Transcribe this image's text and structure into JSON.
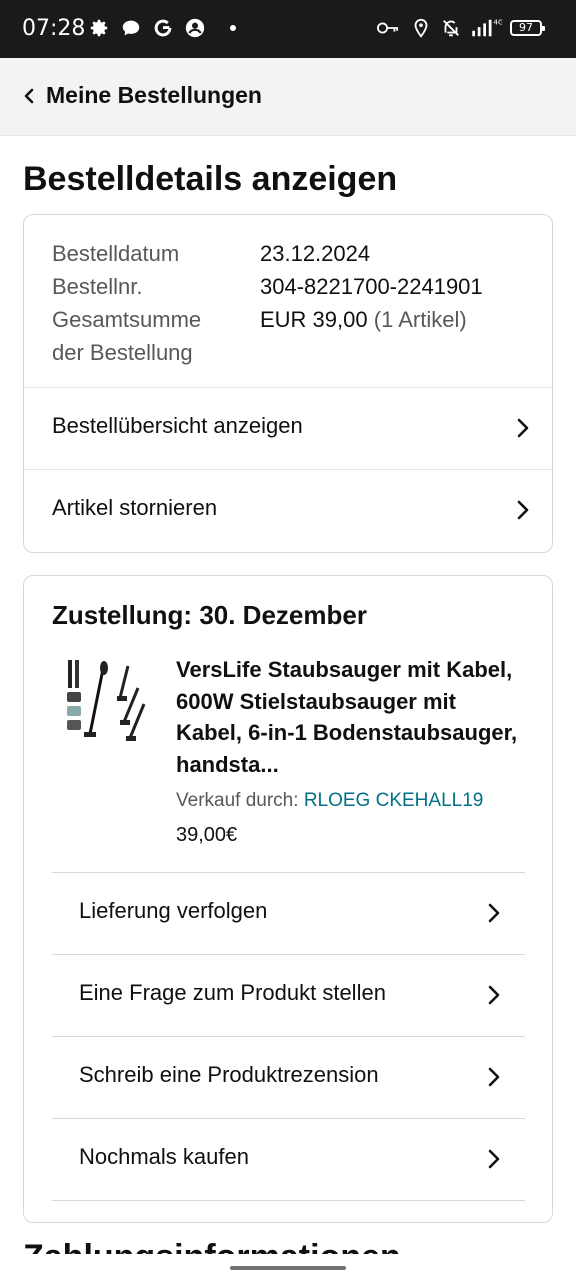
{
  "status_bar": {
    "time": "07:28",
    "network": "4G",
    "battery": "97"
  },
  "nav": {
    "back_label": "Meine Bestellungen"
  },
  "page": {
    "title": "Bestelldetails anzeigen"
  },
  "order_info": {
    "date_label": "Bestelldatum",
    "date_value": "23.12.2024",
    "number_label": "Bestellnr.",
    "number_value": "304-8221700-2241901",
    "total_label_1": "Gesamtsumme",
    "total_label_2": "der Bestellung",
    "total_value": "EUR 39,00",
    "total_count": "(1 Artikel)"
  },
  "order_actions": [
    {
      "label": "Bestellübersicht anzeigen"
    },
    {
      "label": "Artikel stornieren"
    }
  ],
  "shipment": {
    "delivery": "Zustellung: 30. Dezember",
    "product_title": "VersLife Staubsauger mit Kabel, 600W Stielstaubsauger mit Kabel, 6-in-1 Bodenstaubsauger, handsta...",
    "seller_prefix": "Verkauf durch:",
    "seller_name": "RLOEG CKEHALL19",
    "price": "39,00€",
    "actions": [
      {
        "label": "Lieferung verfolgen"
      },
      {
        "label": "Eine Frage zum Produkt stellen"
      },
      {
        "label": "Schreib eine Produktrezension"
      },
      {
        "label": "Nochmals kaufen"
      }
    ]
  },
  "next_section": {
    "heading": "Zahlungsinformationen"
  },
  "colors": {
    "link": "#007185",
    "text": "#0f1111",
    "muted": "#565959",
    "nav_bg": "#f3f3f3"
  },
  "icons": [
    "gear-icon",
    "chat-bubble-icon",
    "google-icon",
    "account-icon",
    "key-icon",
    "location-icon",
    "bell-off-icon",
    "signal-icon",
    "battery-icon",
    "back-chevron-icon",
    "chevron-right-icon"
  ]
}
